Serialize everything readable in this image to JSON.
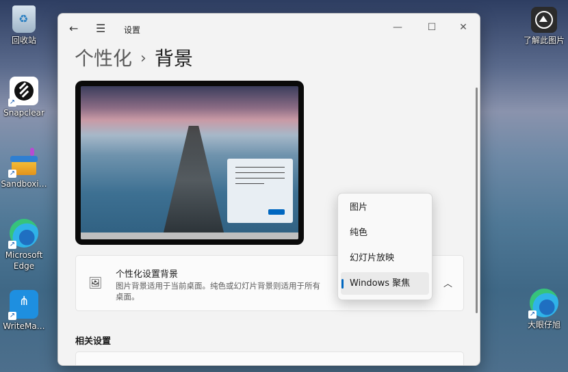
{
  "desktop": {
    "left_icons": [
      {
        "label": "回收站",
        "icon": "recycle-bin-icon"
      },
      {
        "label": "Snapclear",
        "icon": "snapclear-icon"
      },
      {
        "label": "Sandboxi…",
        "icon": "sandboxie-icon"
      },
      {
        "label": "Microsoft Edge",
        "icon": "edge-icon"
      },
      {
        "label": "WriteMa…",
        "icon": "writemapper-icon"
      }
    ],
    "right_icons": [
      {
        "label": "了解此图片",
        "icon": "learn-picture-icon"
      },
      {
        "label": "大眼仔旭",
        "icon": "edge-icon"
      }
    ]
  },
  "window": {
    "app_title": "设置",
    "breadcrumb": {
      "parent": "个性化",
      "separator": "›",
      "current": "背景"
    }
  },
  "background_card": {
    "title": "个性化设置背景",
    "description": "图片背景适用于当前桌面。纯色或幻灯片背景则适用于所有桌面。"
  },
  "dropdown": {
    "options": [
      "图片",
      "纯色",
      "幻灯片放映",
      "Windows 聚焦"
    ],
    "selected": "Windows 聚焦"
  },
  "related_settings": {
    "heading": "相关设置"
  },
  "colors": {
    "accent": "#0067c0"
  }
}
